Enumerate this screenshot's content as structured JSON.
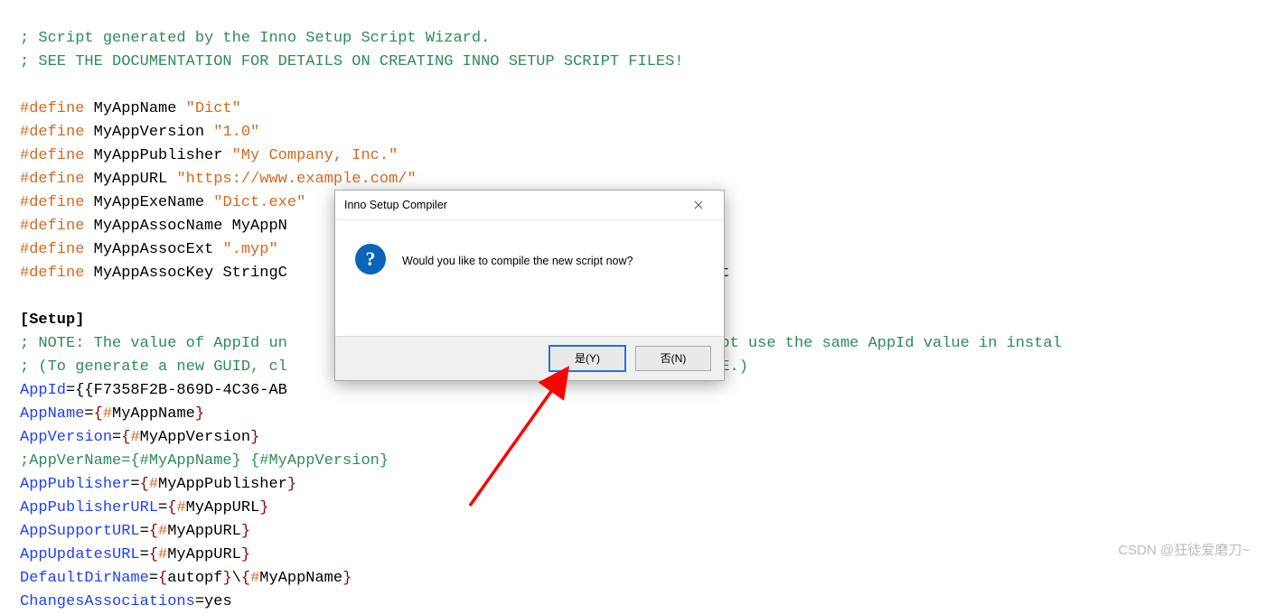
{
  "code": {
    "l1": "; Script generated by the Inno Setup Script Wizard.",
    "l2": "; SEE THE DOCUMENTATION FOR DETAILS ON CREATING INNO SETUP SCRIPT FILES!",
    "defines": [
      {
        "kw": "#define",
        "name": "MyAppName",
        "val": "\"Dict\""
      },
      {
        "kw": "#define",
        "name": "MyAppVersion",
        "val": "\"1.0\""
      },
      {
        "kw": "#define",
        "name": "MyAppPublisher",
        "val": "\"My Company, Inc.\""
      },
      {
        "kw": "#define",
        "name": "MyAppURL",
        "val": "\"https://www.example.com/\""
      },
      {
        "kw": "#define",
        "name": "MyAppExeName",
        "val": "\"Dict.exe\""
      }
    ],
    "l_assocname_pre": "#define",
    "l_assocname_name": "MyAppAssocName",
    "l_assocname_mid": "MyAppN",
    "l_assocext_pre": "#define",
    "l_assocext_name": "MyAppAssocExt",
    "l_assocext_val": "\".myp\"",
    "l_assockey_pre": "#define",
    "l_assockey_name": "MyAppAssocKey",
    "l_assockey_mid": "StringC",
    "l_assockey_tail": "MyAppAssocExt",
    "section": "[Setup]",
    "note1": "; NOTE: The value of AppId un",
    "note1_tail": "n. Do not use the same AppId value in instal",
    "note2": "; (To generate a new GUID, cl",
    "note2_tail": "the IDE.)",
    "appid_key": "AppId",
    "appid_val": "={{F7358F2B-869D-4C36-AB",
    "appname_key": "AppName",
    "appver_key": "AppVersion",
    "appvername_line": ";AppVerName={#MyAppName} {#MyAppVersion}",
    "apppub_key": "AppPublisher",
    "apppuburl_key": "AppPublisherURL",
    "appsupurl_key": "AppSupportURL",
    "appupdurl_key": "AppUpdatesURL",
    "defdir_key": "DefaultDirName",
    "defdir_val1": "autopf",
    "changes_key": "ChangesAssociations",
    "changes_val": "=yes",
    "ref_MyAppName": "MyAppName",
    "ref_MyAppVersion": "MyAppVersion",
    "ref_MyAppPublisher": "MyAppPublisher",
    "ref_MyAppURL": "MyAppURL",
    "eq": "=",
    "lbrace": "{",
    "rbrace": "}",
    "hash": "#",
    "bs": "\\"
  },
  "dialog": {
    "title": "Inno Setup Compiler",
    "message": "Would you like to compile the new script now?",
    "yes": "是(Y)",
    "no": "否(N)",
    "question": "?"
  },
  "watermark": "CSDN @狂徒爱磨刀~"
}
